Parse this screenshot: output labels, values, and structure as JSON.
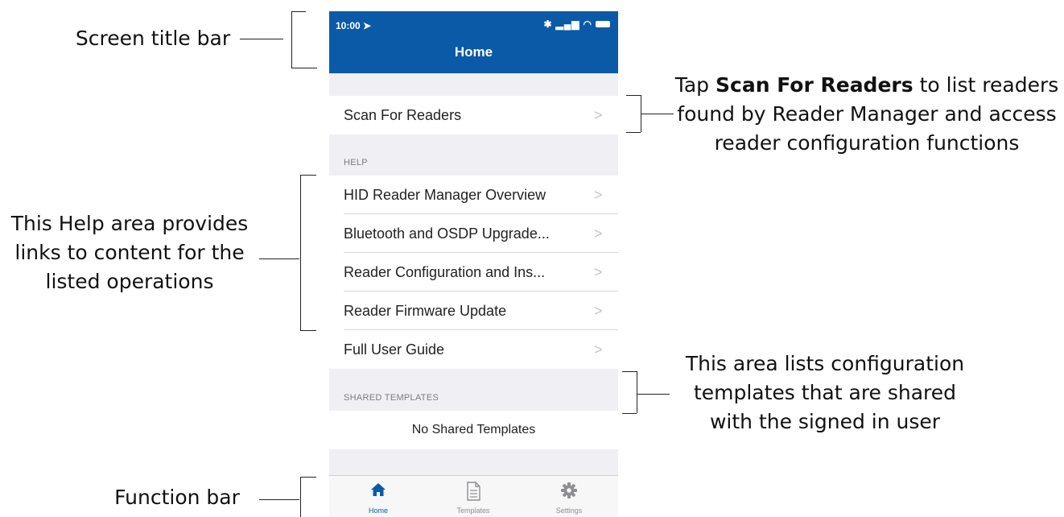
{
  "annotations": {
    "title_bar": "Screen title bar",
    "scan_prefix": "Tap ",
    "scan_bold": "Scan For Readers",
    "scan_line1_rest": " to list readers",
    "scan_line2": "found by Reader Manager and access",
    "scan_line3": "reader configuration functions",
    "help_line1": "This Help area provides",
    "help_line2": "links to content for the",
    "help_line3": "listed operations",
    "templates_line1": "This area lists configuration",
    "templates_line2": "templates that are shared",
    "templates_line3": "with the signed in user",
    "function_bar": "Function bar"
  },
  "status_bar": {
    "time": "10:00"
  },
  "screen": {
    "title": "Home"
  },
  "scan": {
    "label": "Scan For Readers"
  },
  "help": {
    "header": "HELP",
    "items": [
      {
        "label": "HID Reader Manager Overview"
      },
      {
        "label": "Bluetooth and OSDP Upgrade..."
      },
      {
        "label": "Reader Configuration and Ins..."
      },
      {
        "label": "Reader Firmware Update"
      },
      {
        "label": "Full User Guide"
      }
    ]
  },
  "shared_templates": {
    "header": "SHARED TEMPLATES",
    "empty_text": "No Shared Templates"
  },
  "tabs": [
    {
      "label": "Home",
      "icon": "home-icon",
      "active": true
    },
    {
      "label": "Templates",
      "icon": "document-icon",
      "active": false
    },
    {
      "label": "Settings",
      "icon": "gear-icon",
      "active": false
    }
  ],
  "colors": {
    "brand_blue": "#0a5aa8",
    "background_gray": "#efeff4"
  }
}
